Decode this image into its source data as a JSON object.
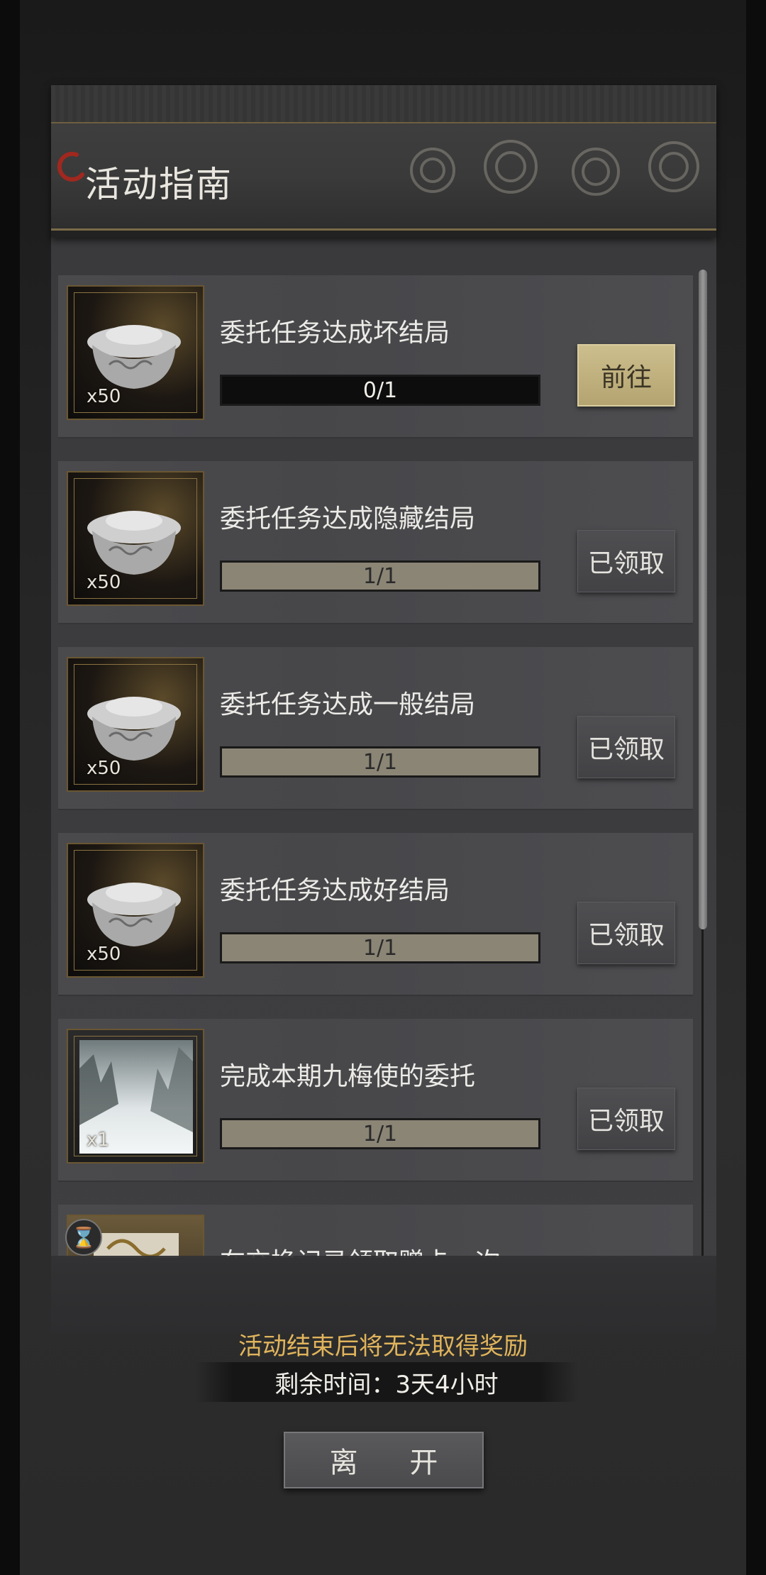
{
  "header": {
    "title": "活动指南"
  },
  "tasks": [
    {
      "title": "委托任务达成坏结局",
      "reward_icon": "silver-ingot-icon",
      "quantity": "x50",
      "progress_text": "0/1",
      "progress": 0,
      "button": "前往"
    },
    {
      "title": "委托任务达成隐藏结局",
      "reward_icon": "silver-ingot-icon",
      "quantity": "x50",
      "progress_text": "1/1",
      "progress": 1,
      "button": "已领取"
    },
    {
      "title": "委托任务达成一般结局",
      "reward_icon": "silver-ingot-icon",
      "quantity": "x50",
      "progress_text": "1/1",
      "progress": 1,
      "button": "已领取"
    },
    {
      "title": "委托任务达成好结局",
      "reward_icon": "silver-ingot-icon",
      "quantity": "x50",
      "progress_text": "1/1",
      "progress": 1,
      "button": "已领取"
    },
    {
      "title": "完成本期九梅使的委托",
      "reward_icon": "ink-landscape-painting-icon",
      "quantity": "x1",
      "progress_text": "1/1",
      "progress": 1,
      "button": "已领取"
    },
    {
      "title": "在交换记录领取赠卡一次",
      "reward_icon": "scroll-card-icon"
    }
  ],
  "footer": {
    "notice": "活动结束后将无法取得奖励",
    "remaining_time": "剩余时间：3天4小时",
    "leave_button": "离 开"
  },
  "colors": {
    "accent_gold": "#e0b45c",
    "go_button": "#cdbf8e",
    "progress_fill": "#8b8576"
  }
}
